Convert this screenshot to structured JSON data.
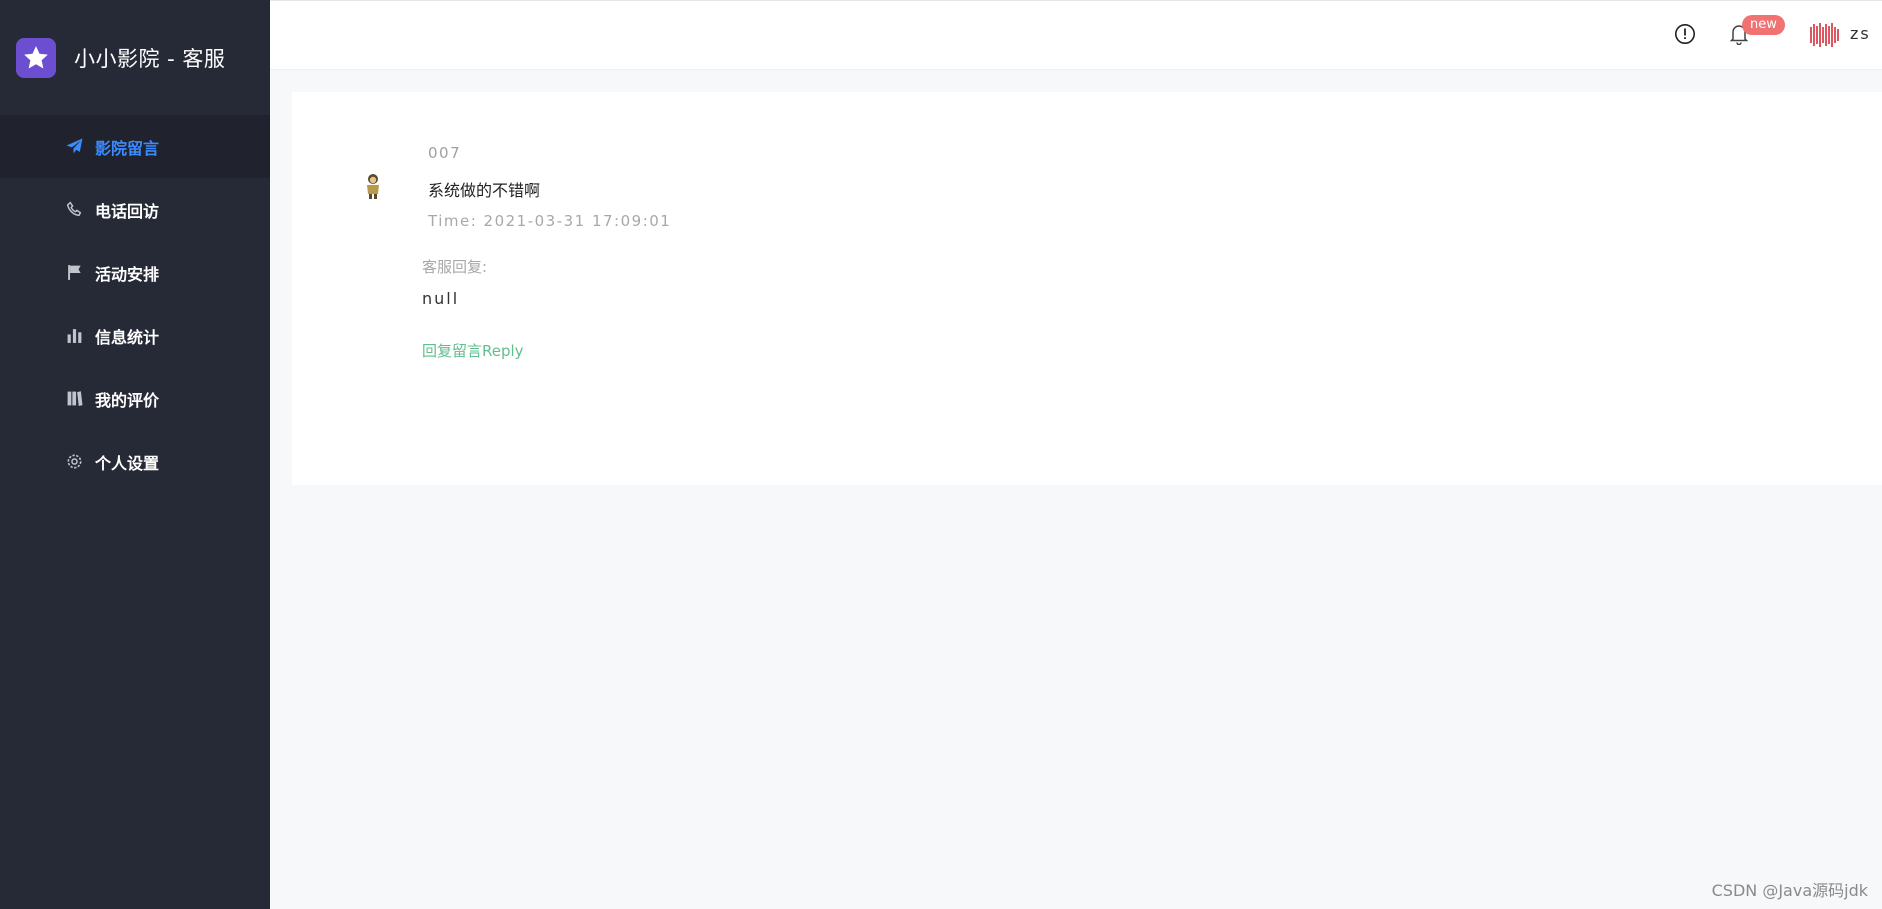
{
  "sidebar": {
    "brand": {
      "title": "小小影院 - 客服",
      "logo_icon": "star-icon",
      "logo_color": "#6b4fd0"
    },
    "items": [
      {
        "label": "影院留言",
        "icon": "paper-plane-icon",
        "active": true
      },
      {
        "label": "电话回访",
        "icon": "phone-icon",
        "active": false
      },
      {
        "label": "活动安排",
        "icon": "flag-icon",
        "active": false
      },
      {
        "label": "信息统计",
        "icon": "bar-chart-icon",
        "active": false
      },
      {
        "label": "我的评价",
        "icon": "book-icon",
        "active": false
      },
      {
        "label": "个人设置",
        "icon": "gear-icon",
        "active": false
      }
    ],
    "background_color": "#262a36",
    "active_color": "#3b8bff"
  },
  "header": {
    "info_icon": "info-circle-icon",
    "bell_icon": "bell-icon",
    "badge_text": "new",
    "badge_color": "#f07272",
    "username": "zs"
  },
  "message": {
    "user": "007",
    "text": "系统做的不错啊",
    "time": "Time: 2021-03-31 17:09:01",
    "reply_label": "客服回复:",
    "reply_text": "null",
    "reply_link": "回复留言Reply",
    "link_color": "#5fbf8e"
  },
  "watermark": "CSDN @Java源码jdk"
}
